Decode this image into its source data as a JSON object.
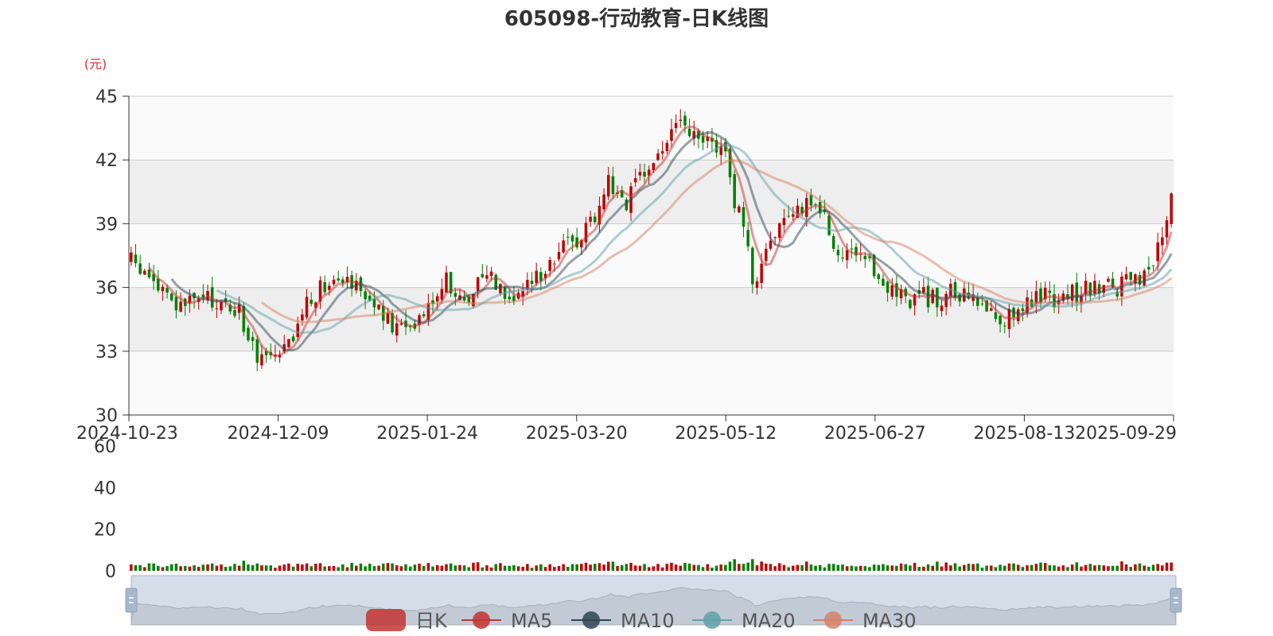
{
  "chart_data": {
    "type": "candlestick",
    "title": "605098-行动教育-日K线图",
    "unit_label": "(元)",
    "price_axis": {
      "ylim": [
        30,
        45
      ],
      "ticks": [
        "45",
        "42",
        "39",
        "36",
        "33",
        "30"
      ]
    },
    "volume_axis": {
      "ylim": [
        0,
        60
      ],
      "ticks": [
        "60",
        "40",
        "20",
        "0"
      ]
    },
    "date_labels": [
      "2024-10-23",
      "2024-12-09",
      "2025-01-24",
      "2025-03-20",
      "2025-05-12",
      "2025-06-27",
      "2025-08-13",
      "2025-09-29"
    ],
    "num_days": 232,
    "close_anchors": [
      [
        0,
        37.2
      ],
      [
        5,
        36.3
      ],
      [
        10,
        35.0
      ],
      [
        15,
        35.5
      ],
      [
        20,
        35.2
      ],
      [
        24,
        34.9
      ],
      [
        27,
        33.0
      ],
      [
        30,
        32.8
      ],
      [
        33,
        32.6
      ],
      [
        36,
        33.5
      ],
      [
        38,
        35.0
      ],
      [
        42,
        36.0
      ],
      [
        46,
        36.8
      ],
      [
        50,
        36.2
      ],
      [
        53,
        35.5
      ],
      [
        56,
        34.5
      ],
      [
        59,
        34.0
      ],
      [
        62,
        34.3
      ],
      [
        65,
        35.0
      ],
      [
        68,
        35.8
      ],
      [
        70,
        36.5
      ],
      [
        73,
        35.2
      ],
      [
        76,
        36.0
      ],
      [
        79,
        36.8
      ],
      [
        82,
        36.1
      ],
      [
        85,
        35.6
      ],
      [
        88,
        36.0
      ],
      [
        91,
        36.8
      ],
      [
        94,
        37.5
      ],
      [
        97,
        38.0
      ],
      [
        100,
        38.5
      ],
      [
        103,
        39.5
      ],
      [
        106,
        41.0
      ],
      [
        108,
        40.6
      ],
      [
        110,
        40.0
      ],
      [
        113,
        41.0
      ],
      [
        116,
        42.0
      ],
      [
        119,
        42.8
      ],
      [
        121,
        43.8
      ],
      [
        123,
        43.4
      ],
      [
        126,
        42.8
      ],
      [
        130,
        42.8
      ],
      [
        132,
        42.5
      ],
      [
        134,
        40.0
      ],
      [
        136,
        38.9
      ],
      [
        138,
        36.0
      ],
      [
        140,
        37.5
      ],
      [
        143,
        38.6
      ],
      [
        146,
        38.9
      ],
      [
        150,
        40.2
      ],
      [
        153,
        39.8
      ],
      [
        155,
        38.5
      ],
      [
        158,
        37.5
      ],
      [
        161,
        37.2
      ],
      [
        164,
        36.9
      ],
      [
        167,
        36.3
      ],
      [
        170,
        35.8
      ],
      [
        173,
        35.5
      ],
      [
        176,
        35.6
      ],
      [
        179,
        35.4
      ],
      [
        182,
        35.7
      ],
      [
        185,
        35.5
      ],
      [
        188,
        35.3
      ],
      [
        191,
        34.8
      ],
      [
        194,
        34.5
      ],
      [
        197,
        35.2
      ],
      [
        200,
        35.4
      ],
      [
        203,
        35.6
      ],
      [
        206,
        35.5
      ],
      [
        209,
        35.7
      ],
      [
        212,
        35.9
      ],
      [
        215,
        36.1
      ],
      [
        218,
        36.0
      ],
      [
        221,
        36.2
      ],
      [
        224,
        36.3
      ],
      [
        226,
        36.4
      ],
      [
        231,
        40.1
      ]
    ],
    "series": [
      {
        "name": "日K",
        "color": "#c23531"
      },
      {
        "name": "MA5",
        "color": "#c23531"
      },
      {
        "name": "MA10",
        "color": "#2f4554"
      },
      {
        "name": "MA20",
        "color": "#61a0a8"
      },
      {
        "name": "MA30",
        "color": "#d48265"
      }
    ],
    "colors": {
      "up": "#c00000",
      "down": "#008000",
      "grid": "#cccccc",
      "band": "#eeeeee"
    }
  },
  "datazoom": {
    "start": 0,
    "end": 100
  }
}
